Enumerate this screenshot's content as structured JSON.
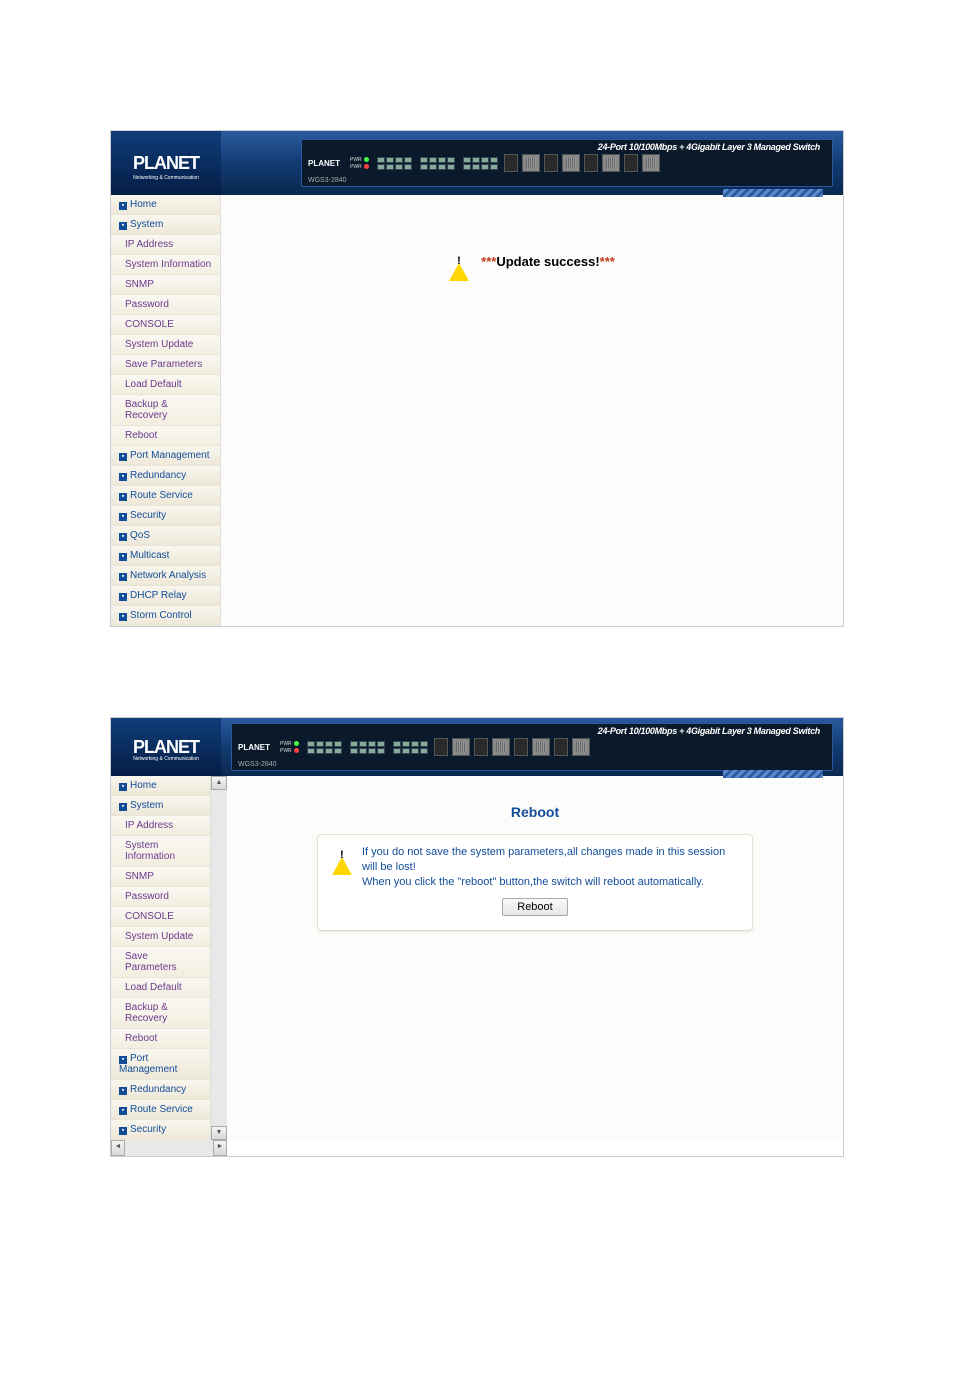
{
  "brand": {
    "name": "PLANET",
    "tagline": "Networking & Communication"
  },
  "device": {
    "model": "WGS3-2840",
    "title": "24-Port 10/100Mbps + 4Gigabit Layer 3 Managed Switch",
    "leds": [
      {
        "label": "PWR",
        "color": "green"
      },
      {
        "label": "PWR",
        "color": "red"
      }
    ]
  },
  "nav": {
    "home": "Home",
    "system": "System",
    "system_items": [
      "IP Address",
      "System Information",
      "SNMP",
      "Password",
      "CONSOLE",
      "System Update",
      "Save Parameters",
      "Load Default",
      "Backup & Recovery",
      "Reboot"
    ],
    "groups": [
      "Port Management",
      "Redundancy",
      "Route Service",
      "Security",
      "QoS",
      "Multicast",
      "Network Analysis",
      "DHCP Relay",
      "Storm Control"
    ]
  },
  "screen1": {
    "message": "***Update success!***"
  },
  "screen2": {
    "title": "Reboot",
    "desc_line1": "If you do not save the system parameters,all changes made in this session will be lost!",
    "desc_line2": "When you click the \"reboot\" button,the switch will reboot automatically.",
    "button": "Reboot"
  }
}
